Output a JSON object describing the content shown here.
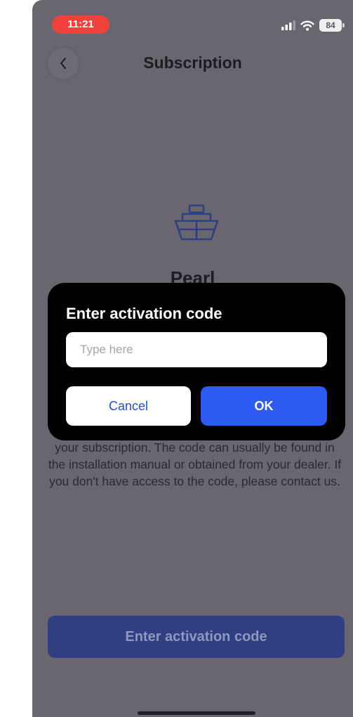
{
  "status_bar": {
    "time": "11:21",
    "battery": "84",
    "icons": [
      "signal-icon",
      "wifi-icon",
      "battery-icon"
    ]
  },
  "header": {
    "title": "Subscription",
    "back_icon": "chevron-left-icon"
  },
  "content": {
    "icon": "ship-icon",
    "plan_name": "Pearl",
    "description": "your subscription. The code can usually be found in the installation manual or obtained from your dealer. If you don't have access to the code, please contact us."
  },
  "footer": {
    "activate_label": "Enter activation code"
  },
  "dialog": {
    "title": "Enter activation code",
    "input_value": "",
    "input_placeholder": "Type here",
    "cancel_label": "Cancel",
    "ok_label": "OK"
  },
  "colors": {
    "background_dimmed": "#69666f",
    "time_pill": "#f0423b",
    "primary": "#2e5bf2",
    "dialog_bg": "#000000"
  }
}
